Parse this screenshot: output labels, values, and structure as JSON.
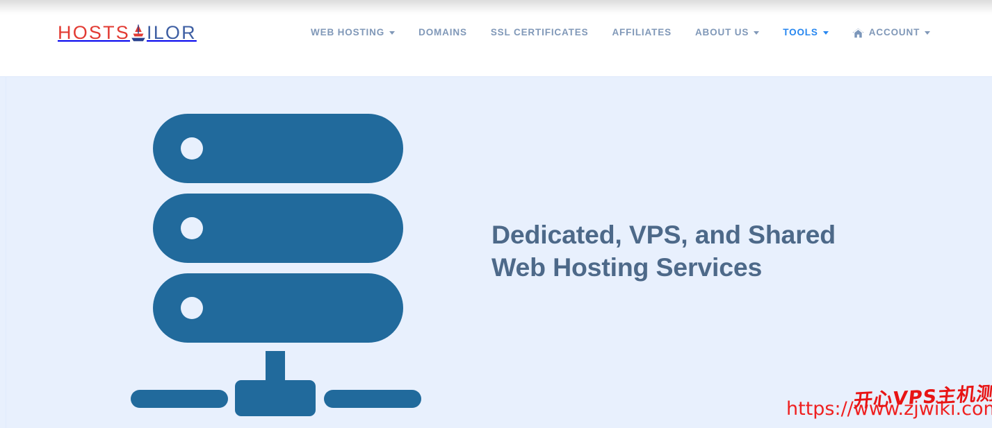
{
  "brand": {
    "logo_part1": "HOSTS",
    "logo_icon": "sailboat-icon",
    "logo_part2": "ILOR",
    "color_red": "#e23b33",
    "color_navy": "#3e5fa3"
  },
  "nav": {
    "items": [
      {
        "label": "WEB HOSTING",
        "has_caret": true,
        "active": false,
        "icon": ""
      },
      {
        "label": "DOMAINS",
        "has_caret": false,
        "active": false,
        "icon": ""
      },
      {
        "label": "SSL CERTIFICATES",
        "has_caret": false,
        "active": false,
        "icon": ""
      },
      {
        "label": "AFFILIATES",
        "has_caret": false,
        "active": false,
        "icon": ""
      },
      {
        "label": "ABOUT US",
        "has_caret": true,
        "active": false,
        "icon": ""
      },
      {
        "label": "TOOLS",
        "has_caret": true,
        "active": true,
        "icon": ""
      },
      {
        "label": "ACCOUNT",
        "has_caret": true,
        "active": false,
        "icon": "home-icon"
      }
    ],
    "color_default": "#8098b8",
    "color_active": "#2787f0"
  },
  "hero": {
    "heading_line1": "Dedicated, VPS, and Shared",
    "heading_line2": "Web Hosting Services",
    "heading_color": "#4d6989",
    "background_color": "#e8f0fd",
    "illustration": "server-stack-network-icon",
    "illustration_color": "#216a9c"
  },
  "watermarks": {
    "url": "https://www.zjwiki.com",
    "chinese": "开心VPS主机测评",
    "color": "#ef2020"
  }
}
